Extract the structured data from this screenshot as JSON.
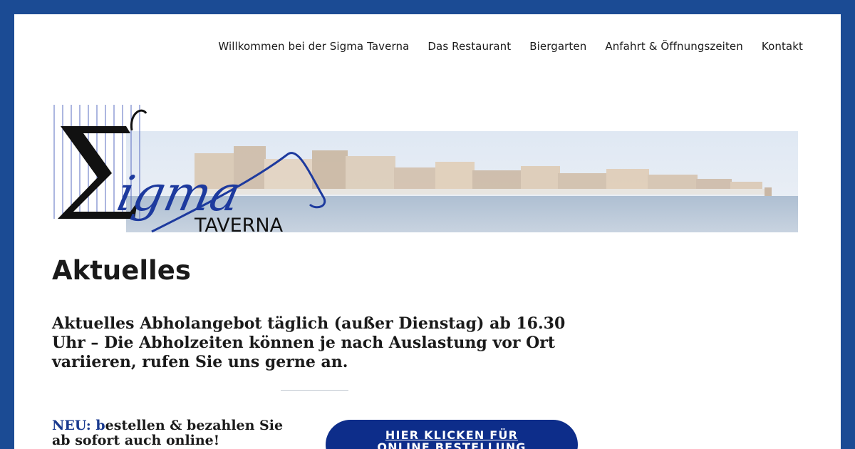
{
  "nav": {
    "items": [
      {
        "label": "Willkommen bei der Sigma Taverna"
      },
      {
        "label": "Das Restaurant"
      },
      {
        "label": "Biergarten"
      },
      {
        "label": "Anfahrt & Öffnungszeiten"
      },
      {
        "label": "Kontakt"
      }
    ]
  },
  "banner": {
    "logo_script": "igma",
    "logo_word": "TAVERNA",
    "logo_symbol": "Σ"
  },
  "page": {
    "title": "Aktuelles",
    "headline": "Aktuelles Abholangebot täglich (außer Dienstag) ab 16.30 Uhr – Die Abholzeiten können je nach Auslastung vor Ort variieren, rufen Sie uns gerne an."
  },
  "promo": {
    "prefix": "NEU: b",
    "text": "estellen & bezahlen Sie ab sofort auch online!"
  },
  "order_button": {
    "line1": "HIER KLICKEN FÜR",
    "line2": "ONLINE BESTELLUNG"
  },
  "colors": {
    "frame": "#1b4b94",
    "button": "#0d2d8a",
    "accent_text": "#1a3a8f"
  }
}
